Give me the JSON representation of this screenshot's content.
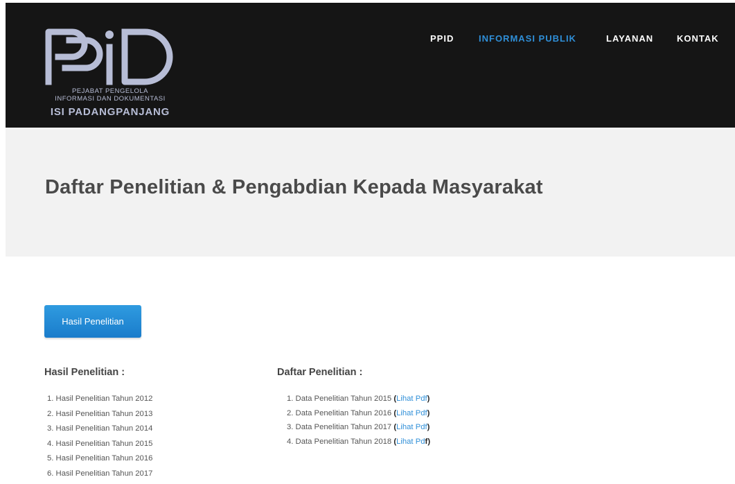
{
  "header": {
    "logo": {
      "mark_text": "PPID",
      "subtitle_line1": "PEJABAT PENGELOLA",
      "subtitle_line2": "INFORMASI DAN DOKUMENTASI",
      "org_name": "ISI PADANGPANJANG"
    },
    "nav": [
      {
        "label": "PPID",
        "active": false
      },
      {
        "label": "INFORMASI PUBLIK",
        "active": true
      },
      {
        "label": "LAYANAN",
        "active": false
      },
      {
        "label": "KONTAK",
        "active": false
      }
    ]
  },
  "hero": {
    "title": "Daftar Penelitian & Pengabdian Kepada Masyarakat"
  },
  "main": {
    "button_label": "Hasil Penelitian",
    "left_column": {
      "title": "Hasil Penelitian :",
      "items": [
        "1. Hasil Penelitian Tahun 2012",
        "2. Hasil Penelitian Tahun 2013",
        "3. Hasil Penelitian Tahun 2014",
        "4. Hasil Penelitian Tahun 2015",
        "5. Hasil Penelitian Tahun 2016",
        "6. Hasil Penelitian Tahun 2017"
      ]
    },
    "right_column": {
      "title": "Daftar Penelitian :",
      "items": [
        {
          "text": "1. Data Penelitian Tahun 2015",
          "link": "Lihat Pdf"
        },
        {
          "text": "2. Data Penelitian Tahun 2016",
          "link": "Lihat Pdf"
        },
        {
          "text": "3. Data Penelitian Tahun 2017",
          "link": "Lihat Pdf"
        },
        {
          "text": "4. Data Penelitian Tahun 2018",
          "link": "Lihat Pd",
          "link_tail": "f"
        }
      ]
    }
  },
  "colors": {
    "accent": "#2f8fd8",
    "header_bg": "#151515",
    "hero_bg": "#f2f2f2",
    "logo": "#b7bdd6"
  }
}
